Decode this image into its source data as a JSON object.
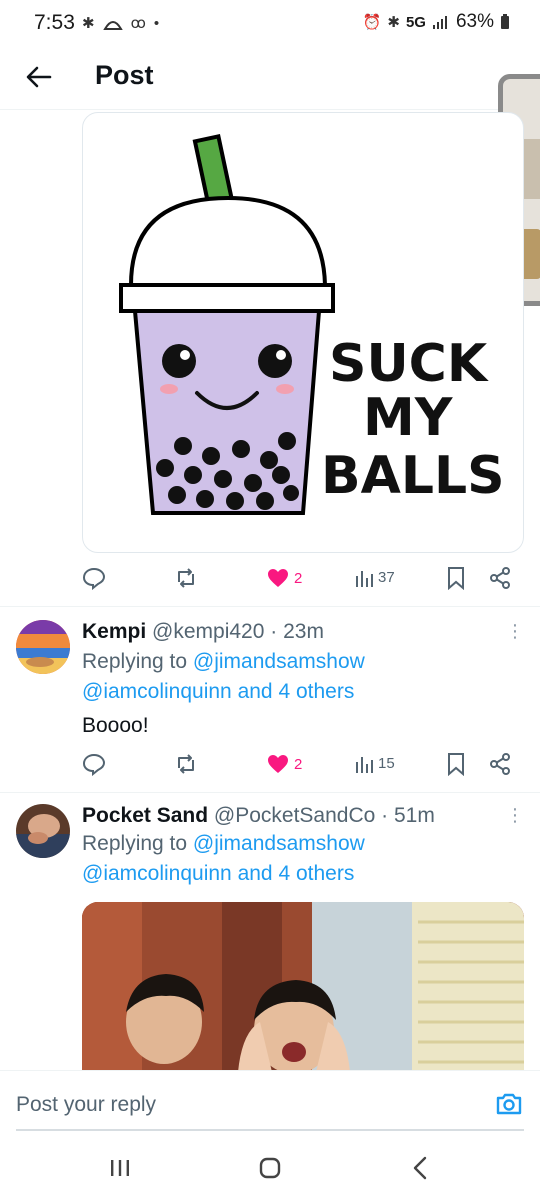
{
  "status_bar": {
    "time": "7:53",
    "network": "5G",
    "battery": "63%"
  },
  "header": {
    "title": "Post"
  },
  "media": {
    "sticker_text_line1": "SUCK",
    "sticker_text_line2": "MY",
    "sticker_text_line3": "BALLS"
  },
  "post_actions": {
    "likes": "2",
    "views": "37"
  },
  "replies": [
    {
      "name": "Kempi",
      "handle": "@kempi420",
      "time": "23m",
      "replying_prefix": "Replying to ",
      "replying_to_1": "@jimandsamshow",
      "replying_to_2": "@iamcolinquinn",
      "others": "and 4 others",
      "text": "Boooo!",
      "likes": "2",
      "views": "15"
    },
    {
      "name": "Pocket Sand",
      "handle": "@PocketSandCo",
      "time": "51m",
      "replying_prefix": "Replying to ",
      "replying_to_1": "@jimandsamshow",
      "replying_to_2": "@iamcolinquinn",
      "others": "and 4 others"
    }
  ],
  "composer": {
    "placeholder": "Post your reply"
  },
  "colors": {
    "link": "#1d9bf0",
    "like": "#f91880",
    "muted": "#536471"
  }
}
